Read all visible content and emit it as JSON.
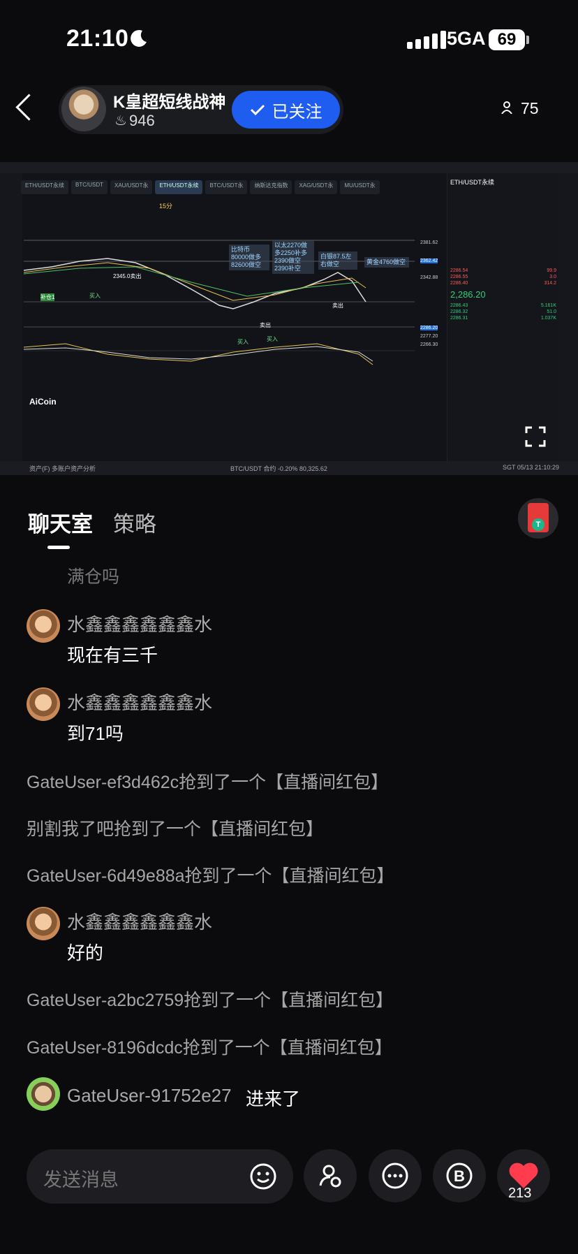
{
  "status": {
    "time": "21:10",
    "network": "5GA",
    "battery": "69"
  },
  "header": {
    "host_name": "K皇超短线战神",
    "host_hot": "946",
    "follow_label": "已关注",
    "viewer_count": "75"
  },
  "chart_embed": {
    "tabs": [
      "ETH/USDT永续",
      "BTC/USDT",
      "XAU/USDT永",
      "ETH/USDT永续",
      "BTC/USDT永",
      "纳斯达克指数",
      "XAG/USDT永",
      "MU/USDT永"
    ],
    "interval_selected": "15分",
    "annotations": [
      "比特币80000做多82600做空",
      "以太2270做多2250补多2390做空 2390补空",
      "白银87.5左右做空",
      "黄金4760做空"
    ],
    "price_labels": [
      "2381.62",
      "2362.42",
      "2342.88",
      "2286.20",
      "2277.20",
      "2266.30"
    ],
    "marks": [
      "卖出",
      "买入",
      "卖出",
      "买入",
      "买入",
      "卖出",
      "2345.0卖出",
      "补仓1"
    ],
    "brand": "AiCoin",
    "right_title": "ETH/USDT永续",
    "right_price": "2,286.20",
    "footer_left": "资产(F)  多账户资产分析",
    "footer_mid": "BTC/USDT 合约 -0.20%  80,325.62",
    "footer_right": "SGT 05/13 21:10:29"
  },
  "tabs": {
    "chat": "聊天室",
    "strategy": "策略"
  },
  "messages": {
    "faded": "满仓吗",
    "m1_user": "水鑫鑫鑫鑫鑫鑫水",
    "m1_text": "现在有三千",
    "m2_user": "水鑫鑫鑫鑫鑫鑫水",
    "m2_text": "到71吗",
    "s1": "GateUser-ef3d462c抢到了一个【直播间红包】",
    "s2": "别割我了吧抢到了一个【直播间红包】",
    "s3": "GateUser-6d49e88a抢到了一个【直播间红包】",
    "m3_user": "水鑫鑫鑫鑫鑫鑫水",
    "m3_text": "好的",
    "s4": "GateUser-a2bc2759抢到了一个【直播间红包】",
    "s5": "GateUser-8196dcdc抢到了一个【直播间红包】",
    "join_user": "GateUser-91752e27",
    "join_text": "进来了"
  },
  "bottom": {
    "input_placeholder": "发送消息",
    "like_count": "213"
  },
  "colors": {
    "accent": "#1f5cf0",
    "heart": "#ff3b4e",
    "background": "#0b0b0d"
  }
}
